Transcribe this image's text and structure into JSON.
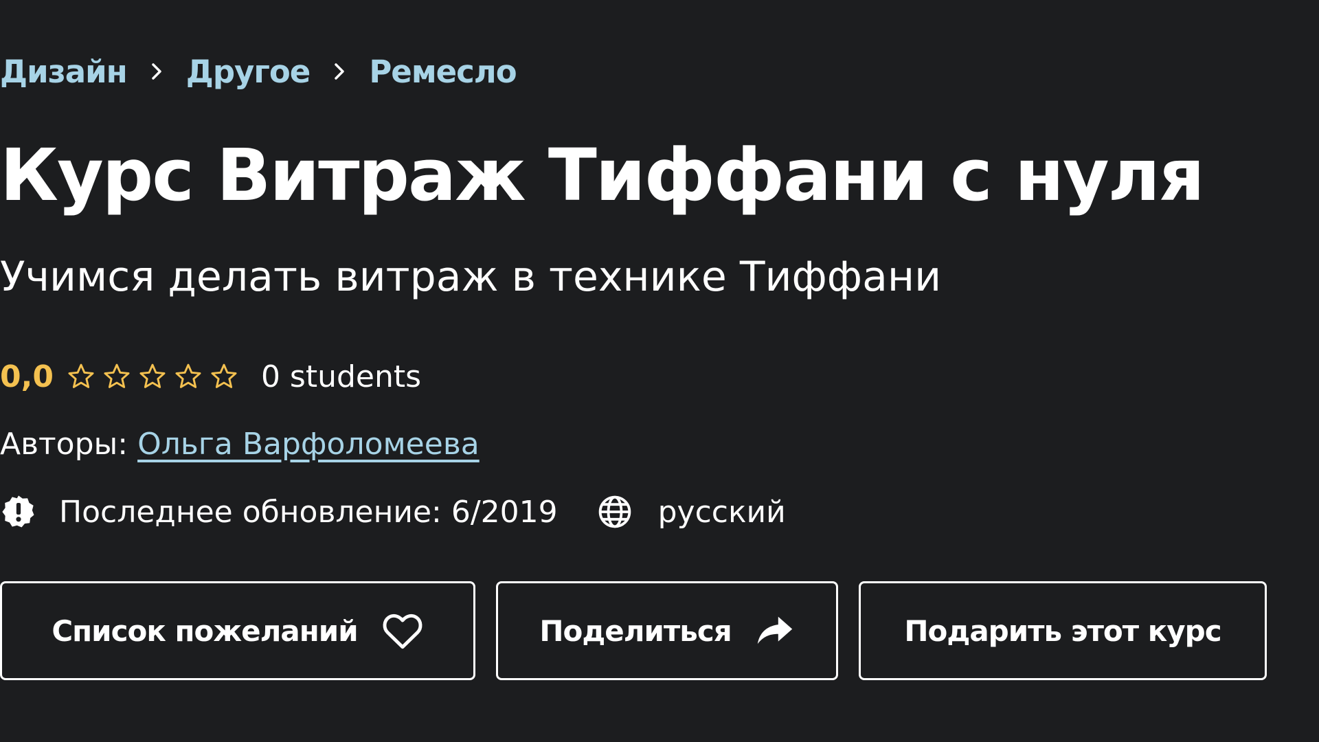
{
  "breadcrumb": {
    "items": [
      {
        "label": "Дизайн"
      },
      {
        "label": "Другое"
      },
      {
        "label": "Ремесло"
      }
    ]
  },
  "course": {
    "title": "Курс Витраж Тиффани с нуля",
    "subtitle": "Учимся делать витраж в технике Тиффани"
  },
  "rating": {
    "value": "0,0",
    "stars_filled": 0,
    "stars_total": 5,
    "students": "0 students"
  },
  "authors": {
    "label": "Авторы:",
    "name": "Ольга Варфоломеева"
  },
  "meta": {
    "updated": "Последнее обновление: 6/2019",
    "updated_icon": "alert-badge-icon",
    "language": "русский",
    "language_icon": "globe-icon"
  },
  "actions": {
    "wishlist_label": "Список пожеланий",
    "wishlist_icon": "heart-icon",
    "share_label": "Поделиться",
    "share_icon": "share-arrow-icon",
    "gift_label": "Подарить этот курс"
  },
  "colors": {
    "background": "#1c1d1f",
    "link": "#a7d3e6",
    "rating": "#f4c150",
    "text": "#ffffff"
  }
}
